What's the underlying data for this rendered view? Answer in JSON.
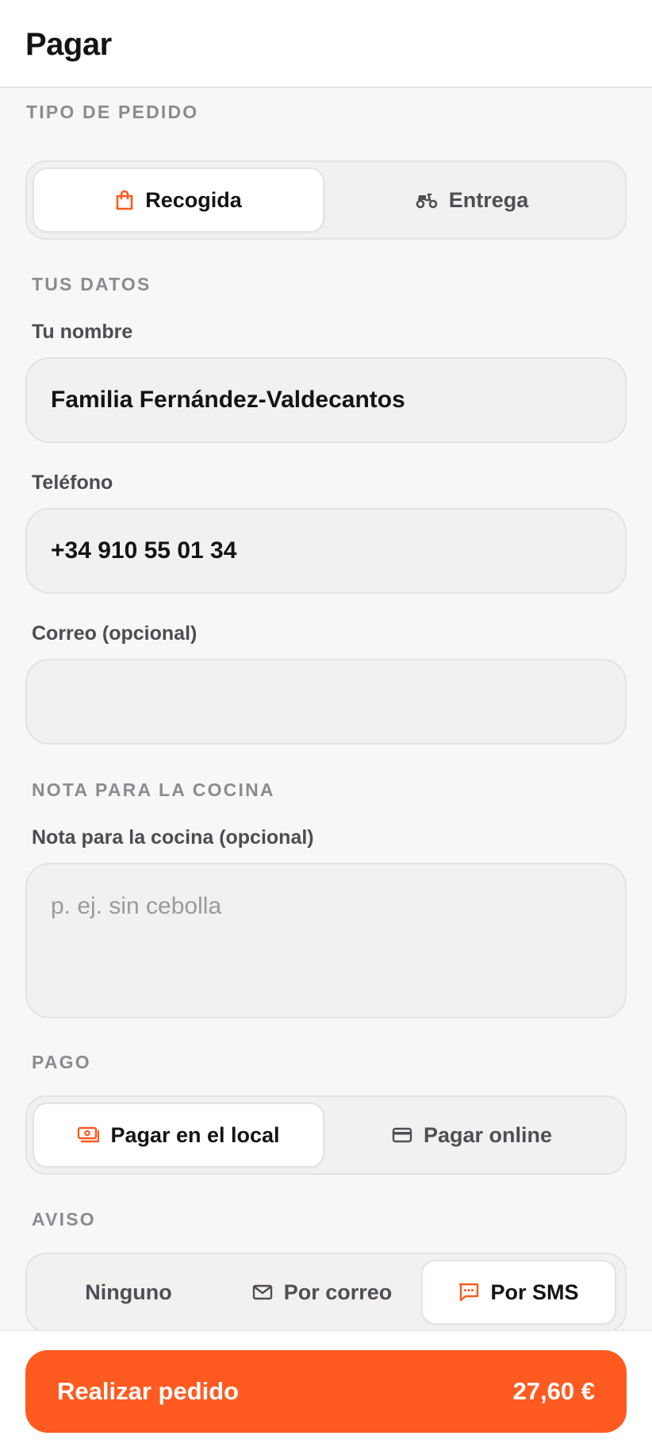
{
  "header": {
    "title": "Pagar"
  },
  "order_type": {
    "section_label": "TIPO DE PEDIDO",
    "options": [
      {
        "label": "Recogida",
        "icon": "shopping-bag-icon",
        "selected": true
      },
      {
        "label": "Entrega",
        "icon": "scooter-icon",
        "selected": false
      }
    ]
  },
  "your_data": {
    "section_label": "TUS DATOS",
    "name": {
      "label": "Tu nombre",
      "value": "Familia Fernández-Valdecantos"
    },
    "phone": {
      "label": "Teléfono",
      "value": "+34 910 55 01 34"
    },
    "email": {
      "label": "Correo (opcional)",
      "value": ""
    }
  },
  "kitchen_note": {
    "section_label": "NOTA PARA LA COCINA",
    "label": "Nota para la cocina (opcional)",
    "placeholder": "p. ej. sin cebolla"
  },
  "payment": {
    "section_label": "PAGO",
    "options": [
      {
        "label": "Pagar en el local",
        "icon": "cash-icon",
        "selected": true
      },
      {
        "label": "Pagar online",
        "icon": "credit-card-icon",
        "selected": false
      }
    ]
  },
  "notice": {
    "section_label": "AVISO",
    "options": [
      {
        "label": "Ninguno",
        "icon": "",
        "selected": false
      },
      {
        "label": "Por correo",
        "icon": "mail-icon",
        "selected": false
      },
      {
        "label": "Por SMS",
        "icon": "sms-icon",
        "selected": true
      }
    ]
  },
  "footer": {
    "cta_label": "Realizar pedido",
    "total": "27,60 €"
  },
  "colors": {
    "accent": "#ff5a1f",
    "background": "#f8f7f5",
    "muted": "#8b8b92"
  }
}
